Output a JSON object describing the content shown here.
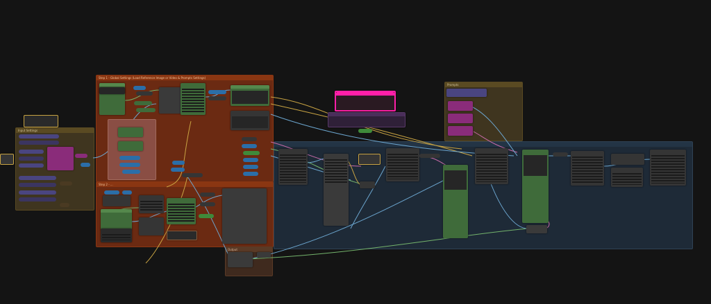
{
  "window_title": "",
  "groups": [
    {
      "id": "group-step-1",
      "title": "Step 1 - Global Settings (Load Reference Image or Video & Prompts Settings)",
      "color": "#6b2a12",
      "title_color": "#8a3612"
    },
    {
      "id": "group-step-2",
      "title": "Step 2 - ...",
      "color": "#6b2a12",
      "title_color": "#8a3612"
    },
    {
      "id": "group-left",
      "title": "Input Settings",
      "color": "#3f351f",
      "title_color": "#5a4a22"
    },
    {
      "id": "group-right-top",
      "title": "Prompts",
      "color": "#3f351f",
      "title_color": "#5a4a22"
    },
    {
      "id": "group-bottom-small",
      "title": "Output",
      "color": "#3f2a1e",
      "title_color": "#5a3a26"
    },
    {
      "id": "group-blue",
      "title": "",
      "color": "#1e2a37",
      "title_color": "#233445"
    }
  ],
  "colors": {
    "canvas_bg": "#141414",
    "node_gray": "#353535",
    "node_green": "#3f6b3a",
    "node_pink": "#ff1fa8",
    "node_purple": "#3b3560",
    "node_magenta": "#8a2c7a",
    "node_blue": "#2b6ea8",
    "wire_blue": "#6ca6cf",
    "wire_yellow": "#c9a443",
    "wire_green": "#74b46c",
    "wire_pink": "#c86aa8"
  }
}
